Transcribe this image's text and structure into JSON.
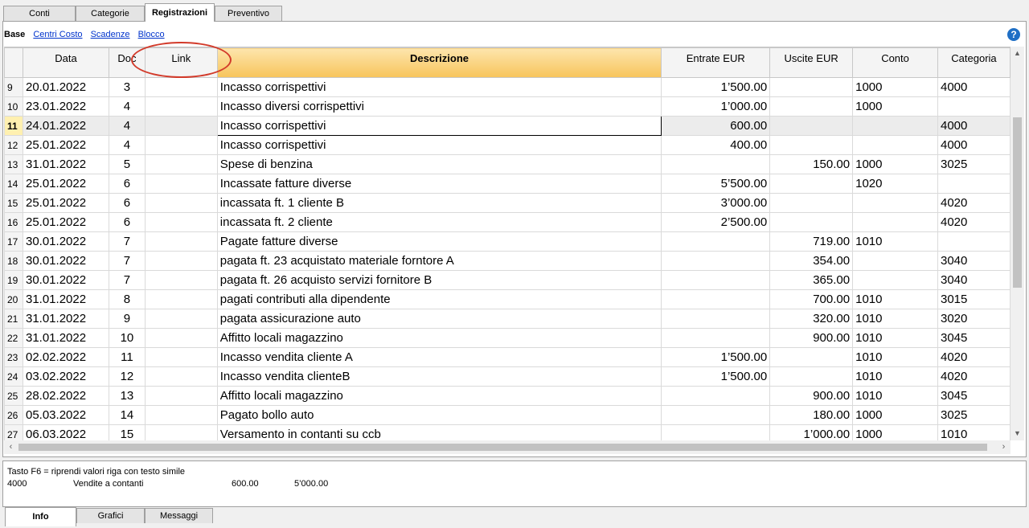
{
  "top_tabs": [
    "Conti",
    "Categorie",
    "Registrazioni",
    "Preventivo"
  ],
  "subtabs": {
    "current": "Base",
    "links": [
      "Centri Costo",
      "Scadenze",
      "Blocco"
    ]
  },
  "columns": [
    "",
    "Data",
    "Doc",
    "Link",
    "Descrizione",
    "Entrate EUR",
    "Uscite EUR",
    "Conto",
    "Categoria"
  ],
  "rows": [
    {
      "n": "9",
      "date": "20.01.2022",
      "doc": "3",
      "link": "",
      "desc": "Incasso corrispettivi",
      "in": "1’500.00",
      "out": "",
      "conto": "1000",
      "cat": "4000"
    },
    {
      "n": "10",
      "date": "23.01.2022",
      "doc": "4",
      "link": "",
      "desc": "Incasso diversi corrispettivi",
      "in": "1’000.00",
      "out": "",
      "conto": "1000",
      "cat": ""
    },
    {
      "n": "11",
      "date": "24.01.2022",
      "doc": "4",
      "link": "",
      "desc": "Incasso corrispettivi",
      "in": "600.00",
      "out": "",
      "conto": "",
      "cat": "4000"
    },
    {
      "n": "12",
      "date": "25.01.2022",
      "doc": "4",
      "link": "",
      "desc": "Incasso corrispettivi",
      "in": "400.00",
      "out": "",
      "conto": "",
      "cat": "4000"
    },
    {
      "n": "13",
      "date": "31.01.2022",
      "doc": "5",
      "link": "",
      "desc": "Spese di benzina",
      "in": "",
      "out": "150.00",
      "conto": "1000",
      "cat": "3025"
    },
    {
      "n": "14",
      "date": "25.01.2022",
      "doc": "6",
      "link": "",
      "desc": "Incassate fatture diverse",
      "in": "5’500.00",
      "out": "",
      "conto": "1020",
      "cat": ""
    },
    {
      "n": "15",
      "date": "25.01.2022",
      "doc": "6",
      "link": "",
      "desc": "incassata ft. 1 cliente B",
      "in": "3’000.00",
      "out": "",
      "conto": "",
      "cat": "4020"
    },
    {
      "n": "16",
      "date": "25.01.2022",
      "doc": "6",
      "link": "",
      "desc": "incassata ft. 2 cliente",
      "in": "2’500.00",
      "out": "",
      "conto": "",
      "cat": "4020"
    },
    {
      "n": "17",
      "date": "30.01.2022",
      "doc": "7",
      "link": "",
      "desc": "Pagate fatture diverse",
      "in": "",
      "out": "719.00",
      "conto": "1010",
      "cat": ""
    },
    {
      "n": "18",
      "date": "30.01.2022",
      "doc": "7",
      "link": "",
      "desc": "pagata ft. 23 acquistato materiale forntore A",
      "in": "",
      "out": "354.00",
      "conto": "",
      "cat": "3040"
    },
    {
      "n": "19",
      "date": "30.01.2022",
      "doc": "7",
      "link": "",
      "desc": "pagata ft. 26 acquisto servizi fornitore B",
      "in": "",
      "out": "365.00",
      "conto": "",
      "cat": "3040"
    },
    {
      "n": "20",
      "date": "31.01.2022",
      "doc": "8",
      "link": "",
      "desc": "pagati contributi alla dipendente",
      "in": "",
      "out": "700.00",
      "conto": "1010",
      "cat": "3015"
    },
    {
      "n": "21",
      "date": "31.01.2022",
      "doc": "9",
      "link": "",
      "desc": "pagata assicurazione auto",
      "in": "",
      "out": "320.00",
      "conto": "1010",
      "cat": "3020"
    },
    {
      "n": "22",
      "date": "31.01.2022",
      "doc": "10",
      "link": "",
      "desc": "Affitto locali magazzino",
      "in": "",
      "out": "900.00",
      "conto": "1010",
      "cat": "3045"
    },
    {
      "n": "23",
      "date": "02.02.2022",
      "doc": "11",
      "link": "",
      "desc": "Incasso vendita cliente A",
      "in": "1’500.00",
      "out": "",
      "conto": "1010",
      "cat": "4020"
    },
    {
      "n": "24",
      "date": "03.02.2022",
      "doc": "12",
      "link": "",
      "desc": "Incasso vendita clienteB",
      "in": "1’500.00",
      "out": "",
      "conto": "1010",
      "cat": "4020"
    },
    {
      "n": "25",
      "date": "28.02.2022",
      "doc": "13",
      "link": "",
      "desc": "Affitto locali magazzino",
      "in": "",
      "out": "900.00",
      "conto": "1010",
      "cat": "3045"
    },
    {
      "n": "26",
      "date": "05.03.2022",
      "doc": "14",
      "link": "",
      "desc": "Pagato bollo auto",
      "in": "",
      "out": "180.00",
      "conto": "1000",
      "cat": "3025"
    },
    {
      "n": "27",
      "date": "06.03.2022",
      "doc": "15",
      "link": "",
      "desc": "Versamento in contanti su ccb",
      "in": "",
      "out": "1’000.00",
      "conto": "1000",
      "cat": "1010"
    }
  ],
  "selected_row": "11",
  "info": {
    "hint": "Tasto F6 = riprendi valori riga con testo simile",
    "account": "4000",
    "account_name": "Vendite a contanti",
    "amount": "600.00",
    "balance": "5’000.00"
  },
  "bottom_tabs": [
    "Info",
    "Grafici",
    "Messaggi"
  ],
  "colors": {
    "highlight": "#f7c45b",
    "annotation": "#d23a2a",
    "link": "#0033cc"
  }
}
